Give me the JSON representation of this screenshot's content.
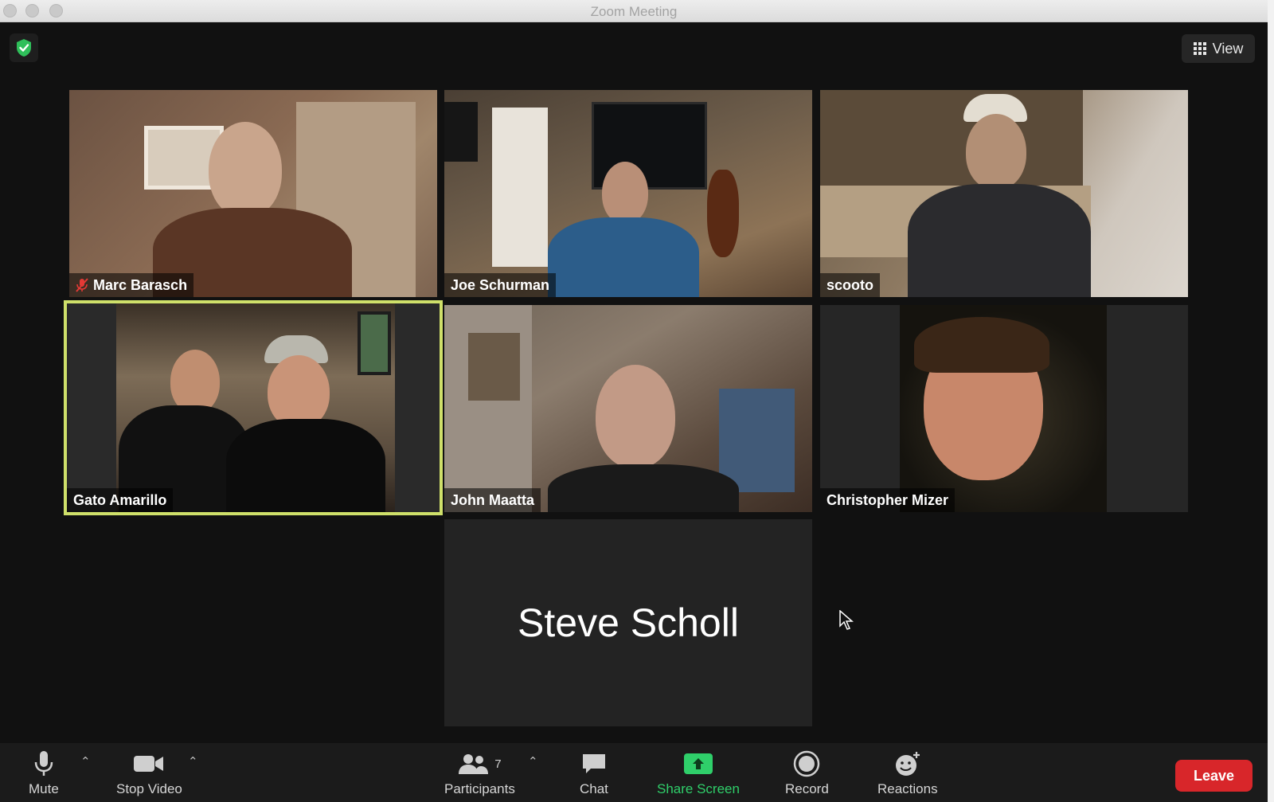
{
  "window": {
    "title": "Zoom Meeting"
  },
  "top_bar": {
    "view_label": "View"
  },
  "participants_tiles": [
    {
      "name": "Marc Barasch",
      "muted": true
    },
    {
      "name": "Joe Schurman",
      "muted": false
    },
    {
      "name": "scooto",
      "muted": false
    },
    {
      "name": "Gato Amarillo",
      "muted": false,
      "active_speaker": true
    },
    {
      "name": "John Maatta",
      "muted": false
    },
    {
      "name": "Christopher Mizer",
      "muted": false
    }
  ],
  "avatar_tile": {
    "name": "Steve Scholl"
  },
  "toolbar": {
    "mute_label": "Mute",
    "stop_video_label": "Stop Video",
    "participants_label": "Participants",
    "participants_count": "7",
    "chat_label": "Chat",
    "share_screen_label": "Share Screen",
    "record_label": "Record",
    "reactions_label": "Reactions",
    "leave_label": "Leave"
  },
  "colors": {
    "active_speaker_border": "#cfe06a",
    "share_green": "#2fcf6a",
    "leave_red": "#d8262a",
    "security_green": "#2fbf5a"
  }
}
